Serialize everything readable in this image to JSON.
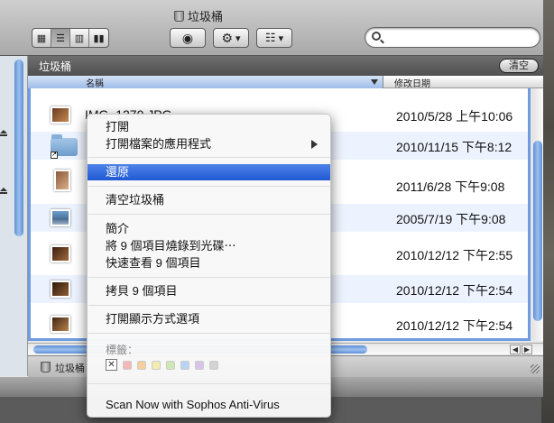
{
  "window": {
    "title": "垃圾桶",
    "icon": "trash-icon"
  },
  "toolbar": {
    "view_buttons": [
      {
        "name": "icon-view-button",
        "icon": "grid-icon",
        "glyph": "▦"
      },
      {
        "name": "list-view-button",
        "icon": "list-icon",
        "glyph": "☰",
        "active": true
      },
      {
        "name": "column-view-button",
        "icon": "columns-icon",
        "glyph": "▥"
      },
      {
        "name": "coverflow-view-button",
        "icon": "coverflow-icon",
        "glyph": "▮▮"
      }
    ],
    "quicklook_glyph": "◉",
    "action_glyph": "⚙",
    "arrange_glyph": "☷",
    "dropdown_glyph": "▾",
    "search_placeholder": ""
  },
  "pathbar": {
    "title": "垃圾桶",
    "empty_button": "清空"
  },
  "columns": {
    "name": "名稱",
    "date": "修改日期"
  },
  "files": [
    {
      "name": "IMG_1270.JPG",
      "date": "2010/5/28 上午10:06",
      "kind": "photo"
    },
    {
      "name": "",
      "date": "2010/11/15 下午8:12",
      "kind": "folder"
    },
    {
      "name": "",
      "date": "2011/6/28 下午9:08",
      "kind": "photo"
    },
    {
      "name": "",
      "date": "2005/7/19 下午9:08",
      "kind": "photo"
    },
    {
      "name": "",
      "date": "2010/12/12 下午2:55",
      "kind": "photo"
    },
    {
      "name": "",
      "date": "2010/12/12 下午2:54",
      "kind": "photo"
    },
    {
      "name": "",
      "date": "2010/12/12 下午2:54",
      "kind": "photo"
    }
  ],
  "statusbar": {
    "label": "垃圾桶"
  },
  "context_menu": {
    "items": [
      {
        "label": "打開"
      },
      {
        "label": "打開檔案的應用程式",
        "submenu": true
      },
      {
        "label": "還原",
        "selected": true
      },
      {
        "label": "清空垃圾桶"
      },
      {
        "label": "簡介"
      },
      {
        "label": "將 9 個項目燒錄到光碟⋯"
      },
      {
        "label": "快速查看 9 個項目"
      },
      {
        "label": "拷貝 9 個項目"
      },
      {
        "label": "打開顯示方式選項"
      },
      {
        "label": "Scan Now with Sophos Anti-Virus"
      }
    ],
    "tags_label": "標籤：",
    "tag_clear_glyph": "✕",
    "tag_colors": [
      "#f4b6b6",
      "#f6cf9f",
      "#f2ecb0",
      "#cfe8b3",
      "#b8d4f2",
      "#d8c3ea",
      "#d3d3d3"
    ]
  },
  "scroll": {
    "left_arrow": "◀",
    "right_arrow": "▶"
  }
}
